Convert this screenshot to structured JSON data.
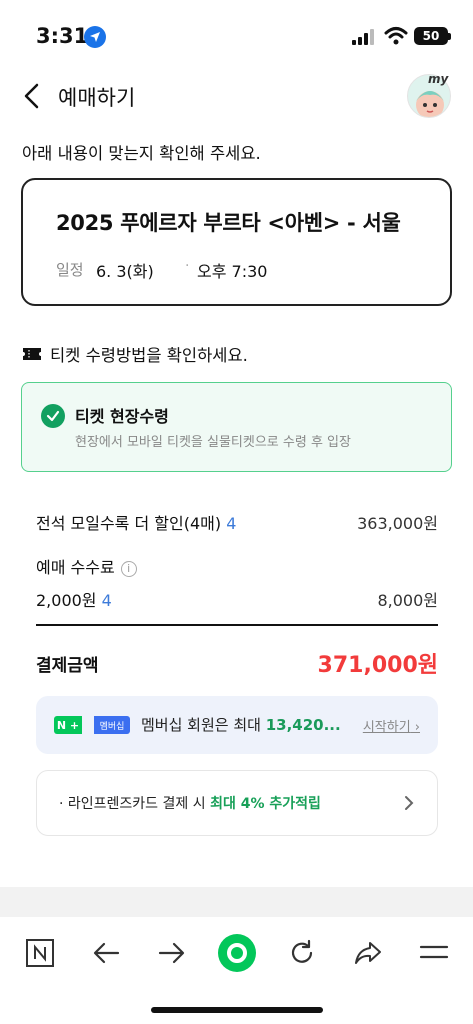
{
  "status_bar": {
    "time": "3:31",
    "battery": "50"
  },
  "header": {
    "title": "예매하기",
    "avatar_label": "my"
  },
  "notice": "아래 내용이 맞는지 확인해 주세요.",
  "event": {
    "title": "2025 푸에르자 부르타 <아벤> - 서울",
    "schedule_label": "일정",
    "date": "6. 3(화)",
    "separator": "·",
    "time": "오후 7:30"
  },
  "ticket_method": {
    "section_title": "티켓 수령방법을 확인하세요.",
    "option_title": "티켓 현장수령",
    "option_desc": "현장에서 모바일 티켓을 실물티켓으로 수령 후 입장"
  },
  "price": {
    "discount_label": "전석 모일수록 더 할인(4매)",
    "discount_count": "4",
    "discount_value": "363,000원",
    "fee_label": "예매 수수료",
    "fee_unit": "2,000원",
    "fee_count": "4",
    "fee_value": "8,000원"
  },
  "total": {
    "label": "결제금액",
    "value": "371,000원"
  },
  "membership": {
    "npay_badge": "N +",
    "member_badge": "멤버십",
    "text": "멤버십 회원은 최대 ",
    "amount": "13,420...",
    "cta": "시작하기"
  },
  "card_promo": {
    "text": "라인프렌즈카드 결제 시 ",
    "highlight": "최대 4% 추가적립"
  },
  "colors": {
    "accent_green": "#03c75a",
    "price_red": "#f23b3b",
    "link_blue": "#3d7bd9"
  }
}
